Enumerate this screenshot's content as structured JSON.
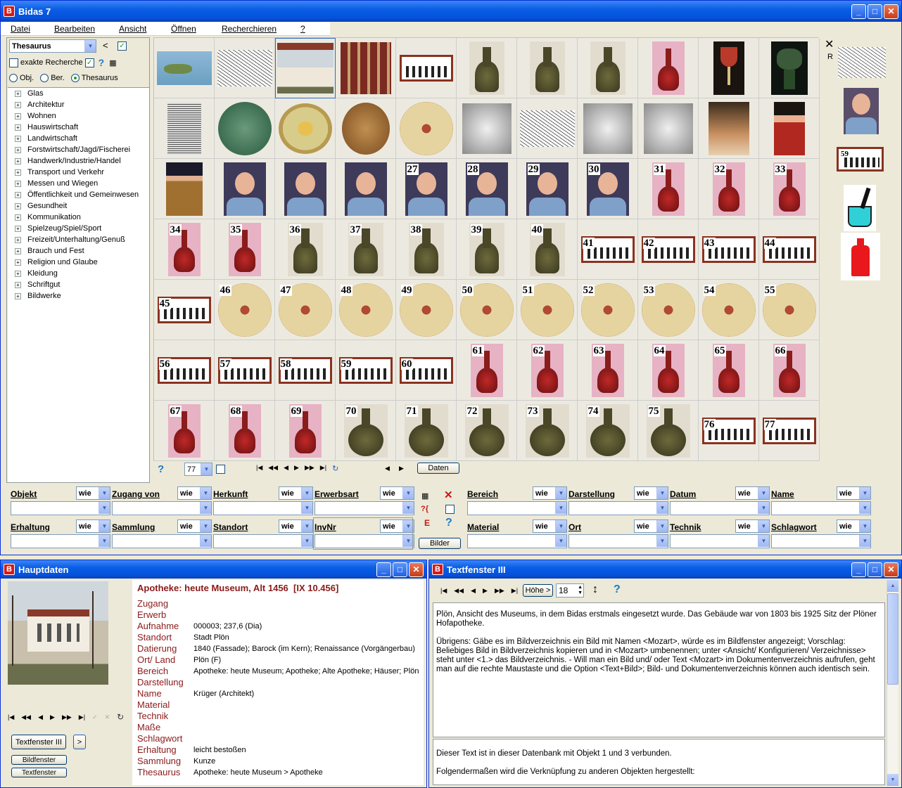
{
  "main_window": {
    "title": "Bidas 7",
    "menu": [
      "Datei",
      "Bearbeiten",
      "Ansicht",
      "Öffnen",
      "Recherchieren",
      "?"
    ]
  },
  "left_panel": {
    "selector": "Thesaurus",
    "back_symbol": "<",
    "exact_search_label": "exakte Recherche",
    "radio_options": [
      "Obj.",
      "Ber.",
      "Thesaurus"
    ],
    "radio_selected": "Thesaurus",
    "tree": [
      "Glas",
      "Architektur",
      "Wohnen",
      "Hauswirtschaft",
      "Landwirtschaft",
      "Forstwirtschaft/Jagd/Fischerei",
      "Handwerk/Industrie/Handel",
      "Transport und Verkehr",
      "Messen und Wiegen",
      "Öffentlichkeit und Gemeinwesen",
      "Gesundheit",
      "Kommunikation",
      "Spielzeug/Spiel/Sport",
      "Freizeit/Unterhaltung/Genuß",
      "Brauch und Fest",
      "Religion und Glaube",
      "Kleidung",
      "Schriftgut",
      "Bildwerke"
    ]
  },
  "grid": {
    "rows": [
      [
        "map",
        "sketch",
        "house",
        "shop",
        "silhouette",
        "bottle",
        "bottle",
        "bottle",
        "redbottle",
        "goblet",
        "roemer"
      ],
      [
        "engraving",
        "greenplate",
        "flowerplate",
        "brownplate",
        "tulipplate",
        "silver",
        "sketch",
        "silver",
        "silver",
        "women",
        "man"
      ],
      [
        "soldier",
        "portrait",
        "portrait",
        "portrait",
        "portrait",
        "portrait",
        "portrait",
        "portrait",
        "redbottle",
        "redbottle",
        "redbottle"
      ],
      [
        "redbottle",
        "redbottle",
        "bottle",
        "bottle",
        "bottle",
        "bottle",
        "bottle",
        "silhouette",
        "silhouette",
        "silhouette",
        "silhouette"
      ],
      [
        "silhouette",
        "tulipplate",
        "tulipplate",
        "tulipplate",
        "tulipplate",
        "tulipplate",
        "tulipplate",
        "tulipplate",
        "tulipplate",
        "tulipplate",
        "tulipplate"
      ],
      [
        "silhouette",
        "silhouette",
        "silhouette",
        "silhouette",
        "silhouette",
        "redbottle",
        "redbottle",
        "redbottle",
        "redbottle",
        "redbottle",
        "redbottle"
      ],
      [
        "redbottle",
        "redbottle",
        "redbottle",
        "roundbottle",
        "roundbottle",
        "roundbottle",
        "roundbottle",
        "roundbottle",
        "roundbottle",
        "silhouette",
        "silhouette"
      ]
    ],
    "numbers": [
      [
        "",
        "",
        "",
        "",
        "",
        "",
        "",
        "",
        "",
        "",
        ""
      ],
      [
        "",
        "",
        "",
        "",
        "",
        "",
        "",
        "",
        "",
        "",
        ""
      ],
      [
        "",
        "",
        "",
        "",
        "27",
        "28",
        "29",
        "30",
        "31",
        "32",
        "33"
      ],
      [
        "34",
        "35",
        "36",
        "37",
        "38",
        "39",
        "40",
        "41",
        "42",
        "43",
        "44"
      ],
      [
        "45",
        "46",
        "47",
        "48",
        "49",
        "50",
        "51",
        "52",
        "53",
        "54",
        "55"
      ],
      [
        "56",
        "57",
        "58",
        "59",
        "60",
        "61",
        "62",
        "63",
        "64",
        "65",
        "66"
      ],
      [
        "67",
        "68",
        "69",
        "70",
        "71",
        "72",
        "73",
        "74",
        "75",
        "76",
        "77"
      ]
    ],
    "count_value": "77",
    "data_button": "Daten"
  },
  "side_thumbs": {
    "close": "✕",
    "r_label": "R",
    "num_label": "59"
  },
  "filter": {
    "fields_left": [
      {
        "label": "Objekt",
        "wie": "wie"
      },
      {
        "label": "Zugang von",
        "wie": "wie"
      },
      {
        "label": "Herkunft",
        "wie": "wie"
      },
      {
        "label": "Erwerbsart",
        "wie": "wie"
      },
      {
        "label": "Erhaltung",
        "wie": "wie"
      },
      {
        "label": "Sammlung",
        "wie": "wie"
      },
      {
        "label": "Standort",
        "wie": "wie"
      },
      {
        "label": "InvNr",
        "wie": "wie"
      }
    ],
    "fields_right": [
      {
        "label": "Bereich",
        "wie": "wie"
      },
      {
        "label": "Darstellung",
        "wie": "wie"
      },
      {
        "label": "Datum",
        "wie": "wie"
      },
      {
        "label": "Name",
        "wie": "wie"
      },
      {
        "label": "Material",
        "wie": "wie"
      },
      {
        "label": "Ort",
        "wie": "wie"
      },
      {
        "label": "Technik",
        "wie": "wie"
      },
      {
        "label": "Schlagwort",
        "wie": "wie"
      }
    ],
    "bilder_button": "Bilder",
    "e_label": "E"
  },
  "hauptdaten": {
    "title": "Hauptdaten",
    "heading": "Apotheke: heute Museum, Alt 1456  [IX 10.456]",
    "labels": [
      "Zugang",
      "Erwerb",
      "Aufnahme",
      "Standort",
      "Datierung",
      "Ort/ Land",
      "Bereich",
      "Darstellung",
      "Name",
      "Material",
      "Technik",
      "Maße",
      "Schlagwort",
      "Erhaltung",
      "Sammlung",
      "Thesaurus"
    ],
    "values": [
      "",
      "",
      "000003; 237,6 (Dia)",
      "Stadt Plön",
      "1840 (Fassade); Barock (im Kern); Renaissance (Vorgängerbau)",
      "Plön (F)",
      "Apotheke: heute Museum; Apotheke; Alte Apotheke; Häuser; Plön",
      "",
      "Krüger (Architekt)",
      "",
      "",
      "",
      "",
      "leicht bestoßen",
      "Kunze",
      "Apotheke: heute Museum > Apotheke"
    ],
    "btn_textfenster3": "Textfenster III",
    "btn_more": ">",
    "btn_bildfenster": "Bildfenster",
    "btn_textfenster": "Textfenster"
  },
  "textfenster": {
    "title": "Textfenster III",
    "hoehe_button": "Höhe >",
    "font_size": "18",
    "text1": "Plön, Ansicht des Museums, in dem Bidas erstmals eingesetzt wurde. Das Gebäude war von 1803 bis 1925 Sitz der Plöner Hofapotheke.",
    "text2": "Übrigens: Gäbe es im Bildverzeichnis ein Bild mit Namen <Mozart>, würde es im Bildfenster angezeigt; Vorschlag: Beliebiges Bild in Bildverzeichnis kopieren und in <Mozart> umbenennen; unter <Ansicht/ Konfigurieren/ Verzeichnisse> steht unter <1.> das Bildverzeichnis. - Will man ein Bild und/ oder Text <Mozart> im Dokumentenverzeichnis aufrufen, geht man auf die rechte Maustaste und die Option <Text+Bild>; Bild- und Dokumentenverzeichnis können auch identisch sein.",
    "text3": "Dieser Text ist in dieser Datenbank mit Objekt 1 und 3 verbunden.",
    "text4": "Folgendermaßen wird die Verknüpfung zu anderen Objekten hergestellt:"
  }
}
